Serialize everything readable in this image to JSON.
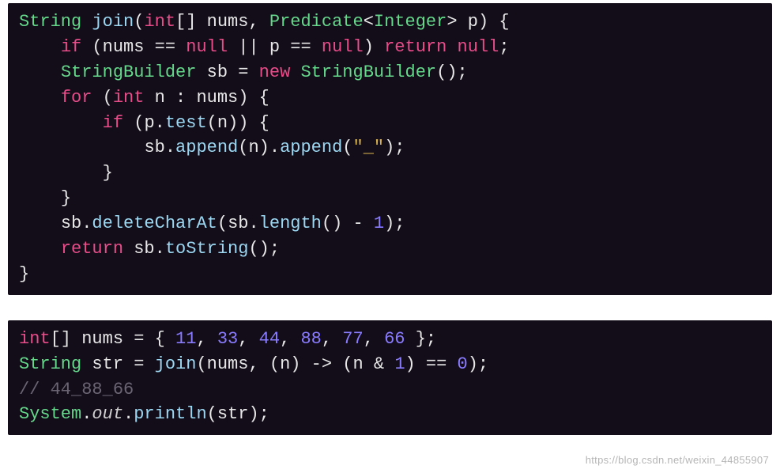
{
  "block1": {
    "l1": {
      "t1": "String",
      "sp1": " ",
      "t2": "join",
      "t3": "(",
      "t4": "int",
      "t5": "[] ",
      "t6": "nums",
      "t7": ", ",
      "t8": "Predicate",
      "t9": "<",
      "t10": "Integer",
      "t11": "> ",
      "t12": "p",
      "t13": ") {"
    },
    "l2": {
      "ind": "    ",
      "t1": "if",
      "t2": " (",
      "t3": "nums",
      "t4": " == ",
      "t5": "null",
      "t6": " || ",
      "t7": "p",
      "t8": " == ",
      "t9": "null",
      "t10": ") ",
      "t11": "return",
      "t12": " ",
      "t13": "null",
      "t14": ";"
    },
    "l3": {
      "ind": "    ",
      "t1": "StringBuilder",
      "t2": " ",
      "t3": "sb",
      "t4": " = ",
      "t5": "new",
      "t6": " ",
      "t7": "StringBuilder",
      "t8": "();"
    },
    "l4": {
      "ind": "    ",
      "t1": "for",
      "t2": " (",
      "t3": "int",
      "t4": " ",
      "t5": "n",
      "t6": " : ",
      "t7": "nums",
      "t8": ") {"
    },
    "l5": {
      "ind": "        ",
      "t1": "if",
      "t2": " (",
      "t3": "p",
      "t4": ".",
      "t5": "test",
      "t6": "(",
      "t7": "n",
      "t8": ")) {"
    },
    "l6": {
      "ind": "            ",
      "t1": "sb",
      "t2": ".",
      "t3": "append",
      "t4": "(",
      "t5": "n",
      "t6": ").",
      "t7": "append",
      "t8": "(",
      "t9": "\"_\"",
      "t10": ");"
    },
    "l7": {
      "ind": "        ",
      "t1": "}"
    },
    "l8": {
      "ind": "    ",
      "t1": "}"
    },
    "l9": {
      "ind": "    ",
      "t1": "sb",
      "t2": ".",
      "t3": "deleteCharAt",
      "t4": "(",
      "t5": "sb",
      "t6": ".",
      "t7": "length",
      "t8": "() - ",
      "t9": "1",
      "t10": ");"
    },
    "l10": {
      "ind": "    ",
      "t1": "return",
      "t2": " ",
      "t3": "sb",
      "t4": ".",
      "t5": "toString",
      "t6": "();"
    },
    "l11": {
      "t1": "}"
    }
  },
  "block2": {
    "l1": {
      "t1": "int",
      "t2": "[] ",
      "t3": "nums",
      "t4": " = { ",
      "t5": "11",
      "t6": ", ",
      "t7": "33",
      "t8": ", ",
      "t9": "44",
      "t10": ", ",
      "t11": "88",
      "t12": ", ",
      "t13": "77",
      "t14": ", ",
      "t15": "66",
      "t16": " };"
    },
    "l2": {
      "t1": "String",
      "t2": " ",
      "t3": "str",
      "t4": " = ",
      "t5": "join",
      "t6": "(",
      "t7": "nums",
      "t8": ", (",
      "t9": "n",
      "t10": ") -> (",
      "t11": "n",
      "t12": " & ",
      "t13": "1",
      "t14": ") == ",
      "t15": "0",
      "t16": ");"
    },
    "l3": {
      "t1": "// 44_88_66"
    },
    "l4": {
      "t1": "System",
      "t2": ".",
      "t3": "out",
      "t4": ".",
      "t5": "println",
      "t6": "(",
      "t7": "str",
      "t8": ");"
    }
  },
  "watermark": "https://blog.csdn.net/weixin_44855907"
}
